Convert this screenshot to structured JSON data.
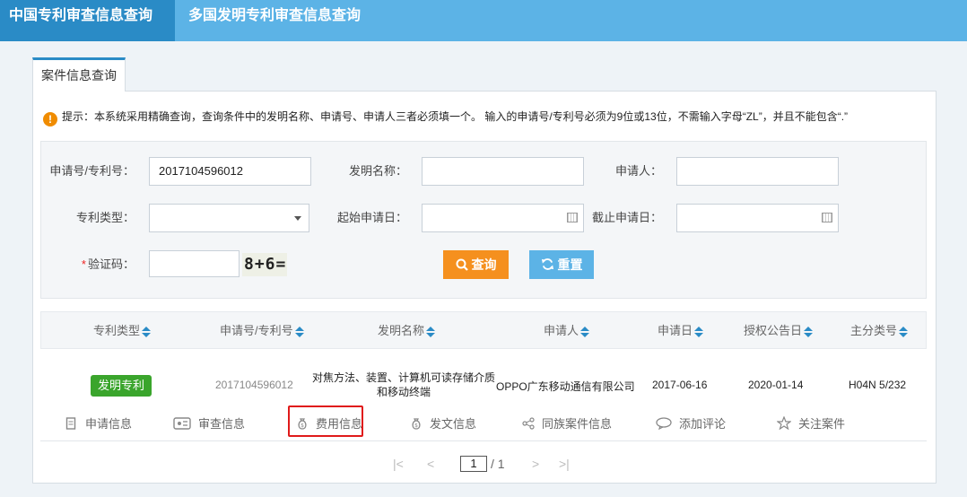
{
  "nav": {
    "tab_active": "中国专利审查信息查询",
    "tab_other": "多国发明专利审查信息查询"
  },
  "section_tab": "案件信息查询",
  "tip": "提示：本系统采用精确查询，查询条件中的发明名称、申请号、申请人三者必须填一个。 输入的申请号/专利号必须为9位或13位，不需输入字母“ZL”，并且不能包含“.”",
  "form": {
    "app_no_label": "申请号/专利号：",
    "app_no_value": "2017104596012",
    "title_label": "发明名称：",
    "title_value": "",
    "applicant_label": "申请人：",
    "applicant_value": "",
    "type_label": "专利类型：",
    "type_value": "",
    "start_date_label": "起始申请日：",
    "start_date_value": "",
    "end_date_label": "截止申请日：",
    "end_date_value": "",
    "captcha_label": "验证码：",
    "captcha_value": "",
    "captcha_text": "8+6=",
    "search_button": "查询",
    "reset_button": "重置"
  },
  "table": {
    "headers": [
      "专利类型",
      "申请号/专利号",
      "发明名称",
      "申请人",
      "申请日",
      "授权公告日",
      "主分类号"
    ],
    "row": {
      "type": "发明专利",
      "app_no": "2017104596012",
      "title": "对焦方法、装置、计算机可读存储介质和移动终端",
      "applicant": "OPPO广东移动通信有限公司",
      "app_date": "2017-06-16",
      "grant_date": "2020-01-14",
      "ipc": "H04N 5/232"
    }
  },
  "actions": {
    "apply_info": "申请信息",
    "review_info": "审查信息",
    "fee_info": "费用信息",
    "doc_info": "发文信息",
    "family_info": "同族案件信息",
    "add_comment": "添加评论",
    "follow_case": "关注案件"
  },
  "pager": {
    "first": "|<",
    "prev": "<",
    "current": "1",
    "total": "/ 1",
    "next": ">",
    "last": ">|"
  },
  "colors": {
    "nav_active": "#2a8bc6",
    "nav_bg": "#5cb3e6",
    "search_btn": "#f5901e",
    "reset_btn": "#5cb3e6",
    "badge": "#3aa52c",
    "highlight": "#e01a1a"
  }
}
